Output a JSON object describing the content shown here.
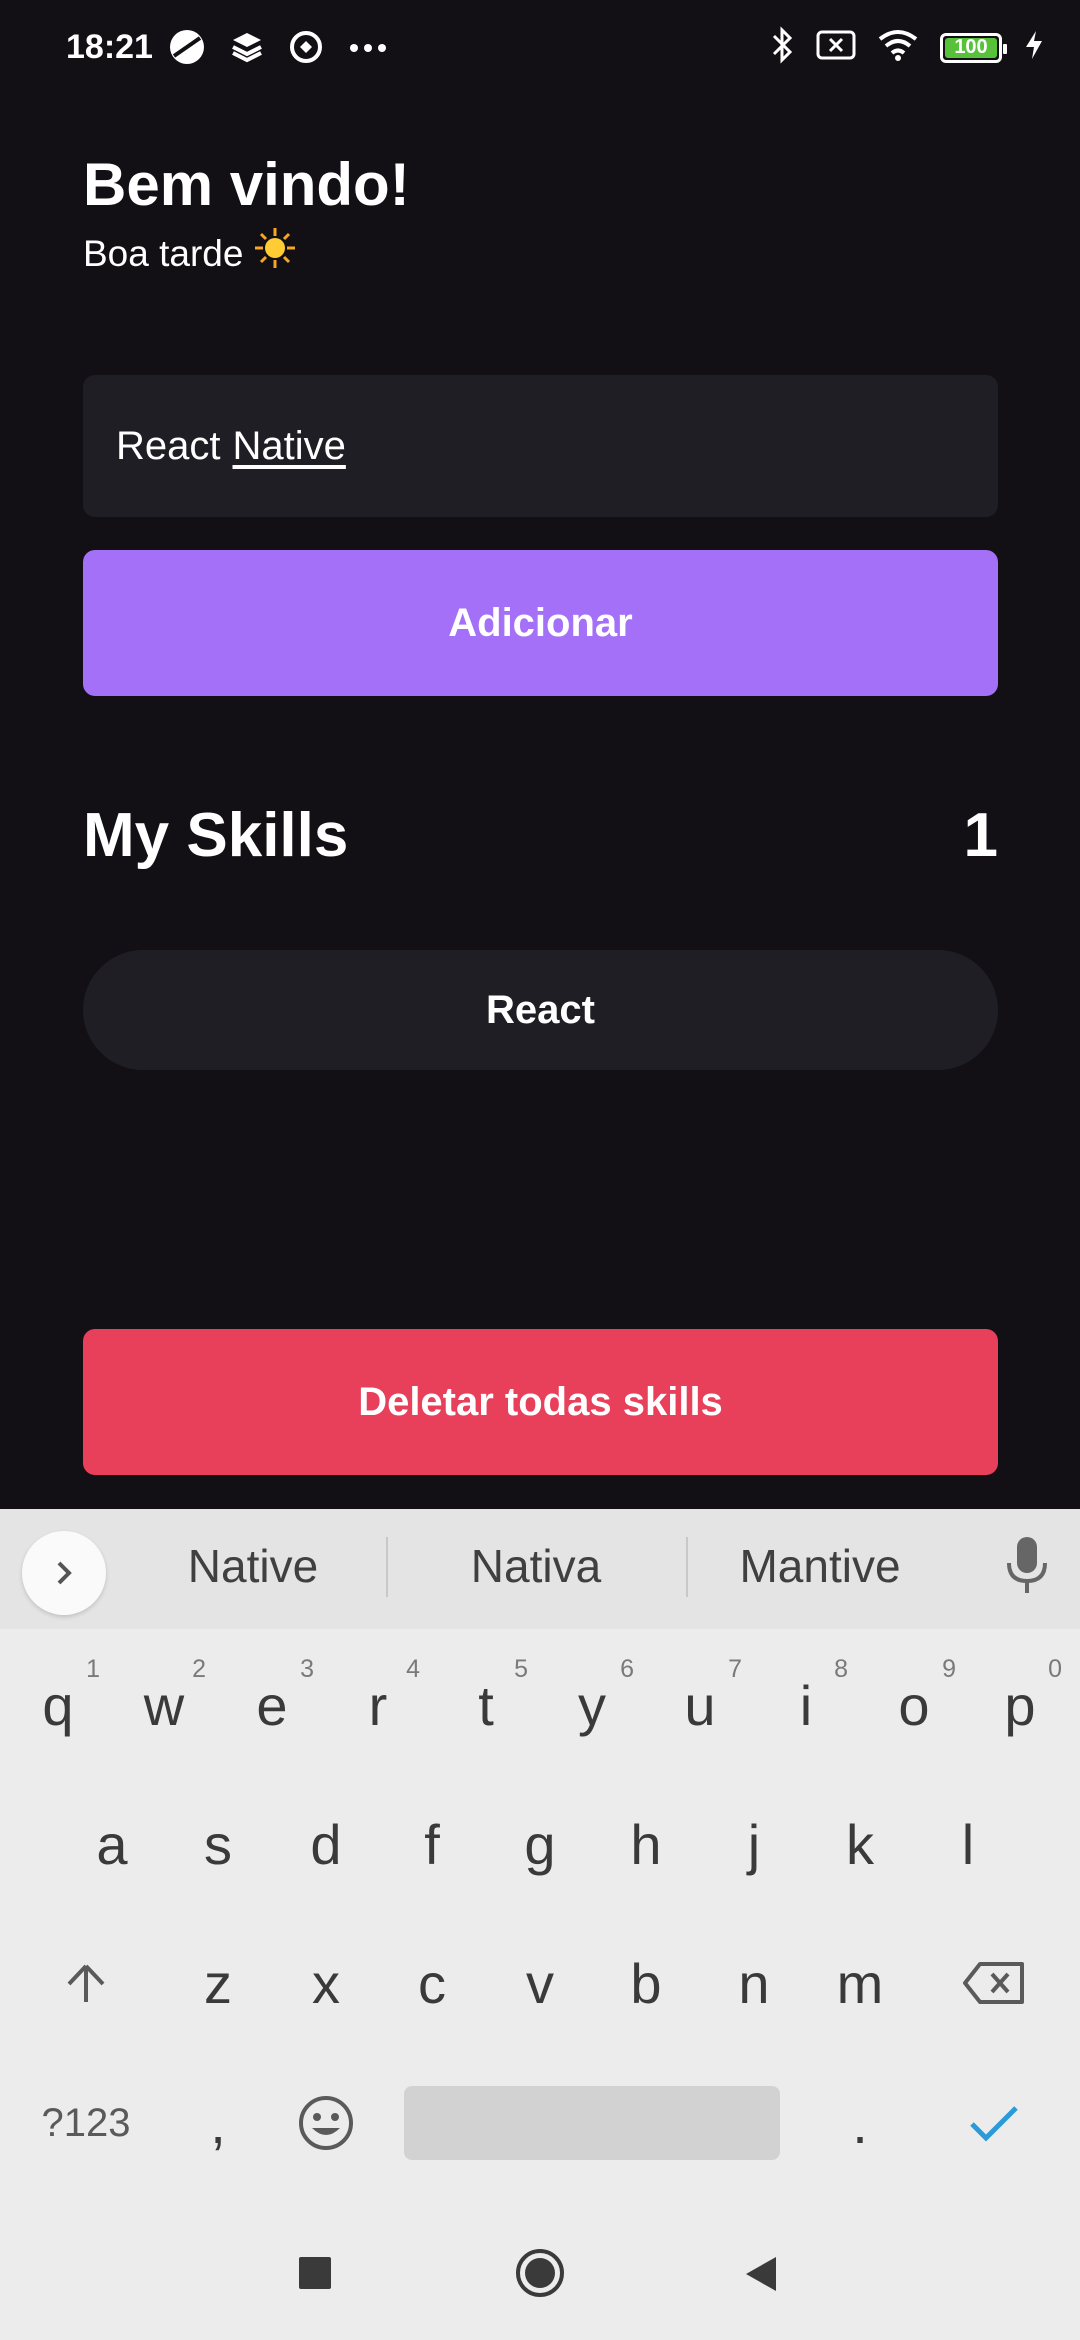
{
  "status_bar": {
    "time": "18:21",
    "left_icons": [
      "app-icon",
      "dropbox-icon",
      "data-saver-icon",
      "more-icon"
    ],
    "right_icons": [
      "bluetooth-icon",
      "sim-off-icon",
      "wifi-icon",
      "battery-icon",
      "charging-icon"
    ],
    "battery_level": "100",
    "battery_color": "#58c13a"
  },
  "app": {
    "title": "Bem vindo!",
    "greeting": "Boa tarde",
    "greeting_emoji": "☀️",
    "input": {
      "value_prefix": "React",
      "value_underlined": "Native"
    },
    "add_button_label": "Adicionar",
    "skills_title": "My Skills",
    "skills_count": "1",
    "skills": [
      "React"
    ],
    "delete_button_label": "Deletar todas skills",
    "colors": {
      "background": "#121015",
      "surface": "#1f1e25",
      "primary": "#a370f7",
      "danger": "#e83f5b"
    }
  },
  "keyboard": {
    "suggestions": [
      "Native",
      "Nativa",
      "Mantive"
    ],
    "row1": [
      {
        "key": "q",
        "hint": "1"
      },
      {
        "key": "w",
        "hint": "2"
      },
      {
        "key": "e",
        "hint": "3"
      },
      {
        "key": "r",
        "hint": "4"
      },
      {
        "key": "t",
        "hint": "5"
      },
      {
        "key": "y",
        "hint": "6"
      },
      {
        "key": "u",
        "hint": "7"
      },
      {
        "key": "i",
        "hint": "8"
      },
      {
        "key": "o",
        "hint": "9"
      },
      {
        "key": "p",
        "hint": "0"
      }
    ],
    "row2": [
      "a",
      "s",
      "d",
      "f",
      "g",
      "h",
      "j",
      "k",
      "l"
    ],
    "row3": [
      "z",
      "x",
      "c",
      "v",
      "b",
      "n",
      "m"
    ],
    "symbols_label": "?123",
    "comma": ",",
    "period": ".",
    "accent": "#2a9bd8"
  },
  "nav_bar": {
    "buttons": [
      "recents-icon",
      "home-icon",
      "back-icon"
    ]
  }
}
